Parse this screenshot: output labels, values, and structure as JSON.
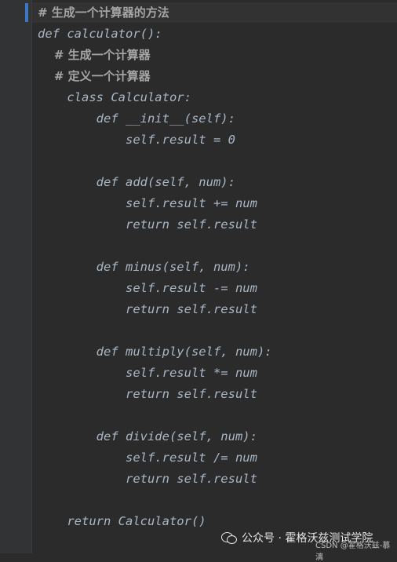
{
  "code": {
    "lines": [
      "# 生成一个计算器的方法",
      "def calculator():",
      "    # 生成一个计算器",
      "    # 定义一个计算器",
      "    class Calculator:",
      "        def __init__(self):",
      "            self.result = 0",
      "",
      "        def add(self, num):",
      "            self.result += num",
      "            return self.result",
      "",
      "        def minus(self, num):",
      "            self.result -= num",
      "            return self.result",
      "",
      "        def multiply(self, num):",
      "            self.result *= num",
      "            return self.result",
      "",
      "        def divide(self, num):",
      "            self.result /= num",
      "            return self.result",
      "",
      "    return Calculator()"
    ]
  },
  "watermark": {
    "text": "公众号 · 霍格沃兹测试学院",
    "csdn": "CSDN @霍格沃兹-慕漓"
  },
  "colors": {
    "background": "#2b2b2b",
    "code_text": "#a9b7c6",
    "comment_text": "#a5a5a5",
    "gutter_marker": "#3b76c7"
  }
}
